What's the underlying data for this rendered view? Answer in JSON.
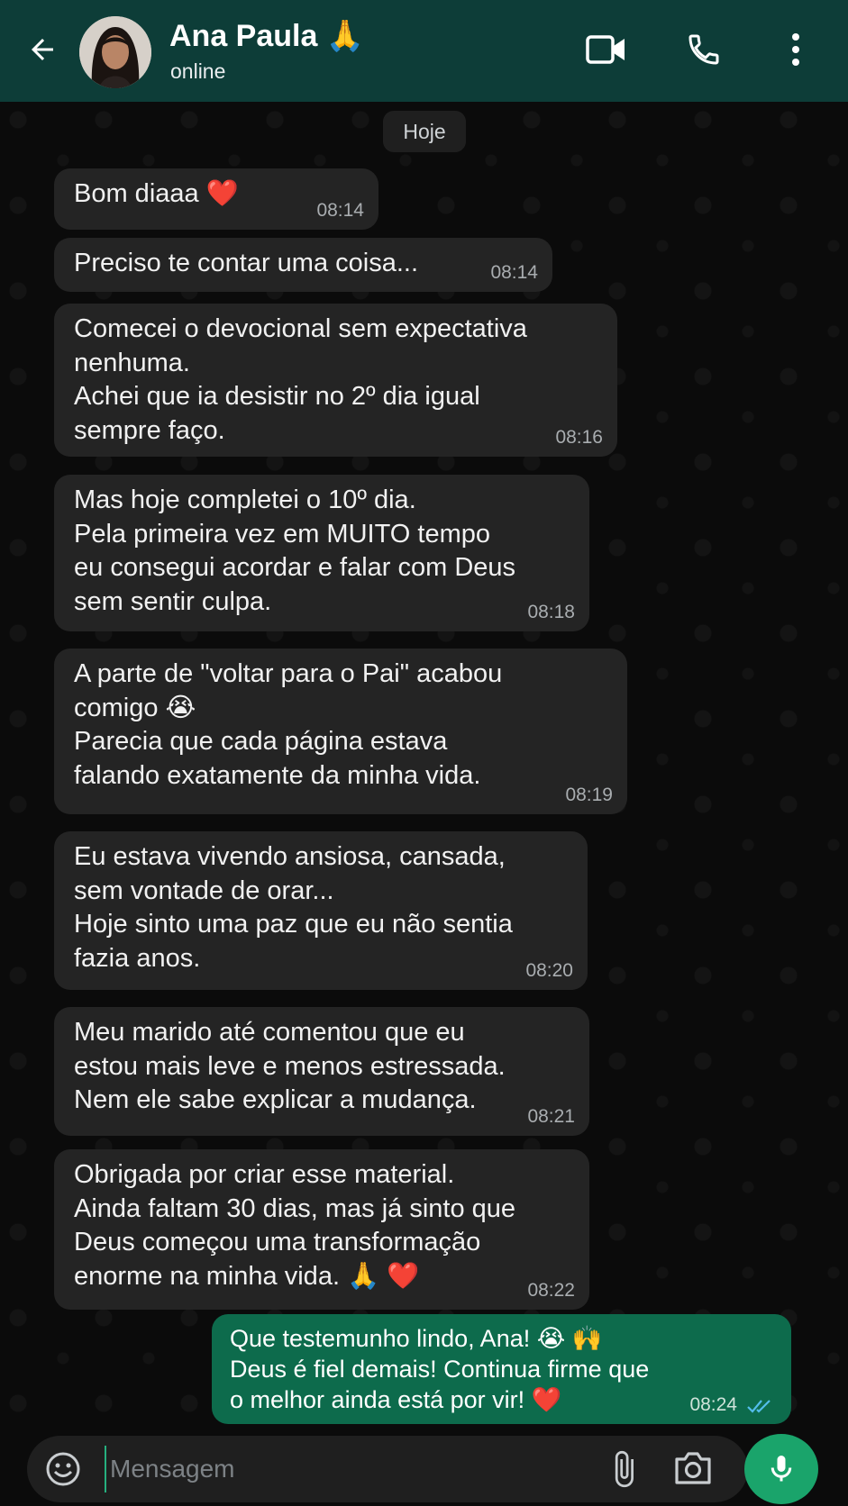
{
  "header": {
    "contact_name": "Ana Paula",
    "contact_emoji": "🙏",
    "status": "online",
    "back_icon": "arrow-left-icon",
    "video_icon": "video-call-icon",
    "call_icon": "phone-icon",
    "menu_icon": "more-vert-icon",
    "background": "#0d3d38"
  },
  "chat": {
    "date_label": "Hoje",
    "messages": [
      {
        "direction": "in",
        "text": "Bom diaaa ❤️",
        "time": "08:14"
      },
      {
        "direction": "in",
        "text": "Preciso te contar uma coisa...",
        "time": "08:14"
      },
      {
        "direction": "in",
        "text": "Comecei o devocional sem expectativa\nnenhuma.\nAchei que ia desistir no 2º dia igual\nsempre faço.",
        "time": "08:16"
      },
      {
        "direction": "in",
        "text": "Mas hoje completei o 10º dia.\nPela primeira vez em MUITO tempo\neu consegui acordar e falar com Deus\nsem sentir culpa.",
        "time": "08:18"
      },
      {
        "direction": "in",
        "text": "A parte de \"voltar para o Pai\" acabou\ncomigo 😭\nParecia que cada página estava\nfalando exatamente da minha vida.",
        "time": "08:19"
      },
      {
        "direction": "in",
        "text": "Eu estava vivendo ansiosa, cansada,\nsem vontade de orar...\nHoje sinto uma paz que eu não sentia\nfazia anos.",
        "time": "08:20"
      },
      {
        "direction": "in",
        "text": "Meu marido até comentou que eu\nestou mais leve e menos estressada.\nNem ele sabe explicar a mudança.",
        "time": "08:21"
      },
      {
        "direction": "in",
        "text": "Obrigada por criar esse material.\nAinda faltam 30 dias, mas já sinto que\nDeus começou uma transformação\nenorme na minha vida. 🙏 ❤️",
        "time": "08:22"
      },
      {
        "direction": "out",
        "text": "Que testemunho lindo, Ana! 😭 🙌\nDeus é fiel demais! Continua firme que\no melhor ainda está por vir! ❤️",
        "time": "08:24",
        "status": "read"
      }
    ],
    "incoming_color": "#242424",
    "outgoing_color": "#0d6b4c",
    "read_tick_color": "#53bdeb"
  },
  "composer": {
    "placeholder": "Mensagem",
    "value": "",
    "emoji_icon": "emoji-icon",
    "attach_icon": "paperclip-icon",
    "camera_icon": "camera-icon",
    "mic_icon": "mic-icon",
    "mic_color": "#1aa46b"
  }
}
